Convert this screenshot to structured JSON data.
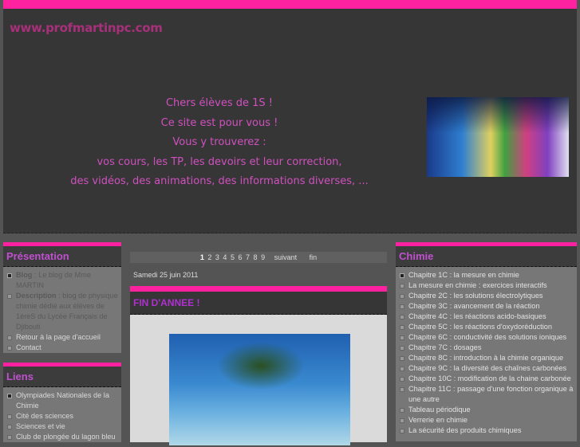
{
  "header": {
    "site_name": "www.profmartinpc.com",
    "intro": [
      "Chers élèves de 1S !",
      "Ce site est pour vous !",
      "Vous y trouverez :",
      "vos cours, les TP, les devoirs et leur correction,",
      "des vidéos, des animations, des informations diverses, ..."
    ]
  },
  "presentation": {
    "title": "Présentation",
    "blog_label": "Blog",
    "blog_text": " : Le blog de Mme MARTIN",
    "desc_label": "Description",
    "desc_text": " : blog de physique chimie dédié aux élèves de 1èreS du Lycée Français de Djibouti",
    "links": [
      "Retour à la page d'accueil",
      "Contact"
    ]
  },
  "liens": {
    "title": "Liens",
    "items": [
      "Olympiades Nationales de la Chimie",
      "Cité des sciences",
      "Sciences et vie",
      "Club de plongée du lagon bleu"
    ]
  },
  "pagination": {
    "pages": [
      "1",
      "2",
      "3",
      "4",
      "5",
      "6",
      "7",
      "8",
      "9"
    ],
    "next": "suivant",
    "last": "fin"
  },
  "post": {
    "date": "Samedi 25 juin 2011",
    "title": "FIN D'ANNEE !"
  },
  "chimie": {
    "title": "Chimie",
    "items": [
      "Chapitre 1C : la mesure en chimie",
      "La mesure en chimie : exercices interactifs",
      "Chapitre 2C : les solutions électrolytiques",
      "Chapitre 3C : avancement de la réaction",
      "Chapitre 4C : les réactions acido-basiques",
      "Chapitre 5C : les réactions d'oxydoréduction",
      "Chapitre 6C : conductivité des solutions ioniques",
      "Chapitre 7C : dosages",
      "Chapitre 8C : introduction à la chimie organique",
      "Chapitre 9C : la diversité des chaînes carbonées",
      "Chapitre 10C : modification de la chaine carbonée",
      "Chapitre 11C : passage d'une fonction organique à une autre",
      "Tableau périodique",
      "Verrerie en chimie",
      "La sécurité des produits chimiques"
    ]
  }
}
